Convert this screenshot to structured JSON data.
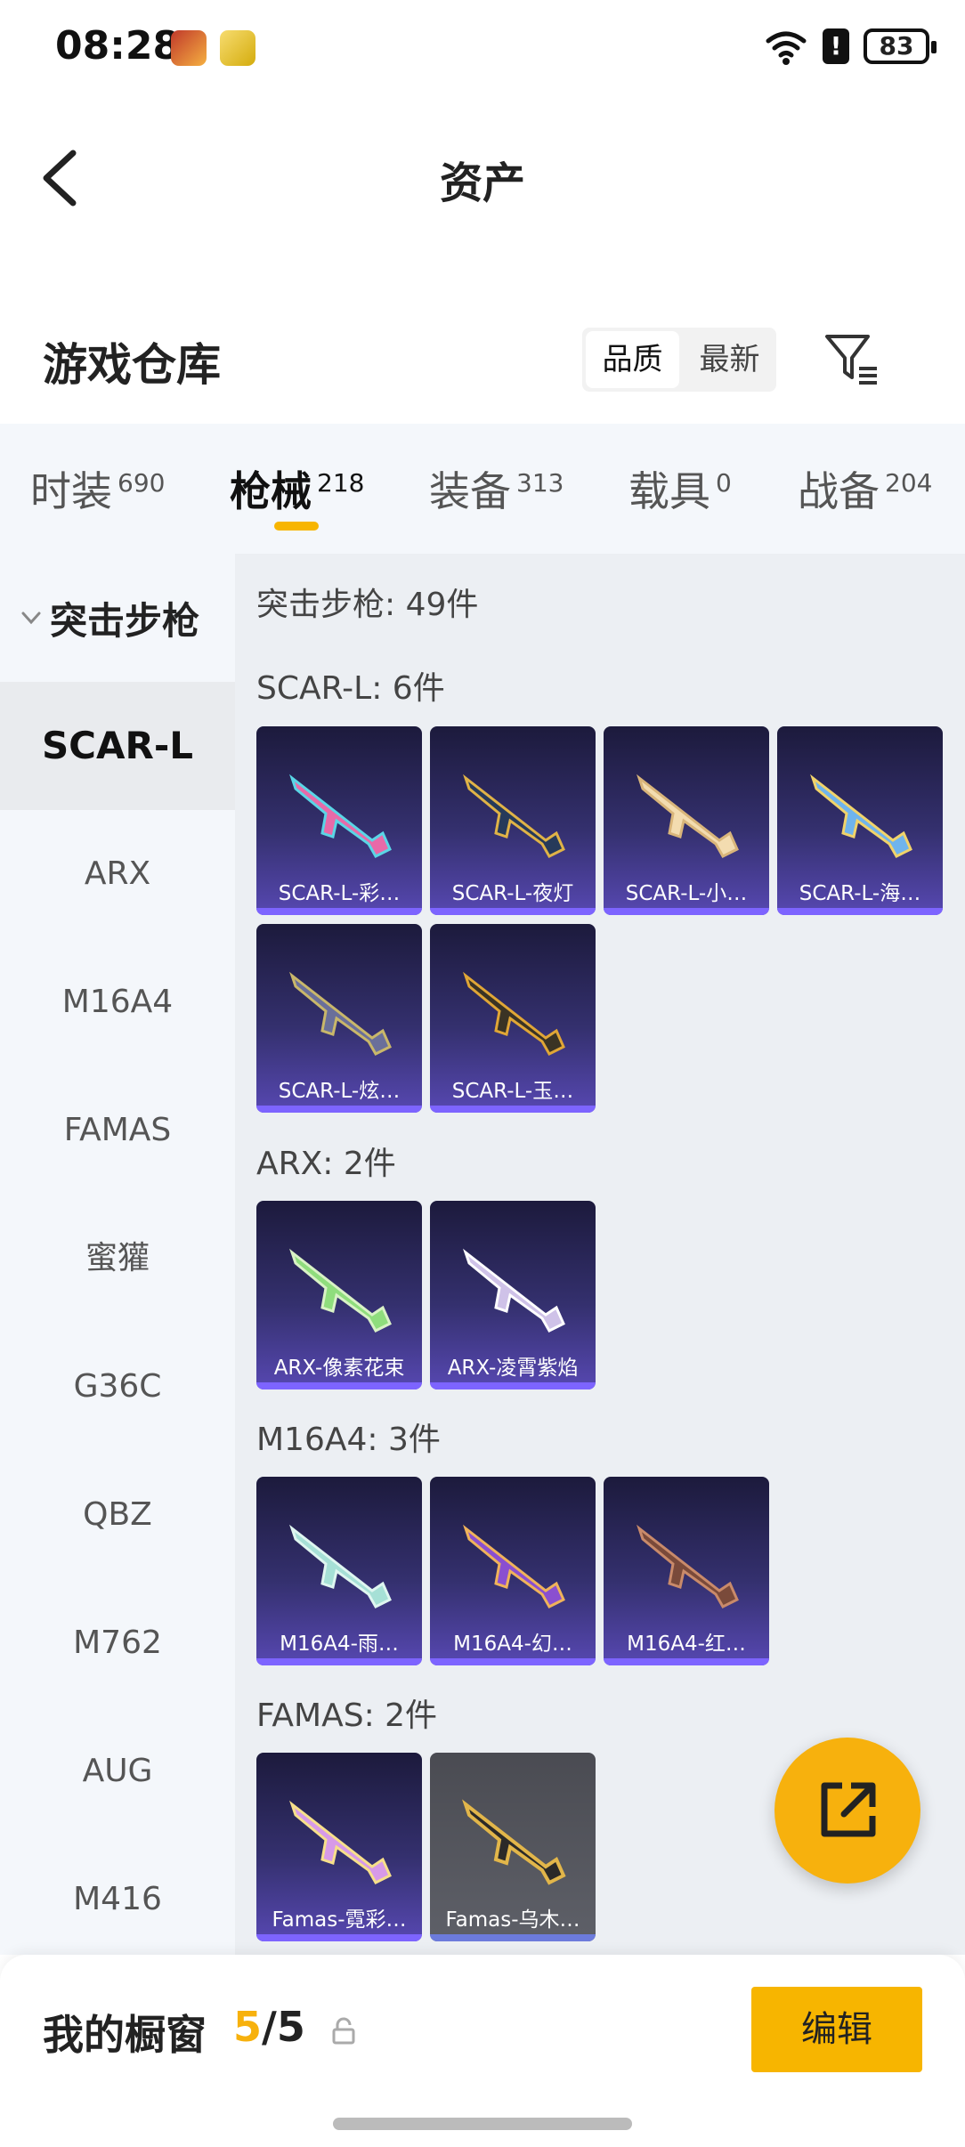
{
  "status": {
    "time": "08:28",
    "battery": "83"
  },
  "header": {
    "title": "资产",
    "back_icon": "chevron-left-icon"
  },
  "warehouse": {
    "title": "游戏仓库",
    "sort_options": [
      "品质",
      "最新"
    ],
    "active_sort": "品质",
    "filter_icon": "filter-icon"
  },
  "tabs": [
    {
      "label": "时装",
      "count": "690"
    },
    {
      "label": "枪械",
      "count": "218"
    },
    {
      "label": "装备",
      "count": "313"
    },
    {
      "label": "载具",
      "count": "0"
    },
    {
      "label": "战备",
      "count": "204"
    }
  ],
  "active_tab": "枪械",
  "sidebar": {
    "category": "突击步枪",
    "items": [
      "SCAR-L",
      "ARX",
      "M16A4",
      "FAMAS",
      "蜜獾",
      "G36C",
      "QBZ",
      "M762",
      "AUG",
      "M416"
    ],
    "active_item": "SCAR-L"
  },
  "main": {
    "category_heading": "突击步枪: 49件",
    "groups": [
      {
        "heading": "SCAR-L: 6件",
        "items": [
          {
            "label": "SCAR-L-彩…"
          },
          {
            "label": "SCAR-L-夜灯"
          },
          {
            "label": "SCAR-L-小…"
          },
          {
            "label": "SCAR-L-海…"
          },
          {
            "label": "SCAR-L-炫…"
          },
          {
            "label": "SCAR-L-玉…"
          }
        ]
      },
      {
        "heading": "ARX: 2件",
        "items": [
          {
            "label": "ARX-像素花束"
          },
          {
            "label": "ARX-凌霄紫焰"
          }
        ]
      },
      {
        "heading": "M16A4: 3件",
        "items": [
          {
            "label": "M16A4-雨…"
          },
          {
            "label": "M16A4-幻…"
          },
          {
            "label": "M16A4-红…"
          }
        ]
      },
      {
        "heading": "FAMAS: 2件",
        "items": [
          {
            "label": "Famas-霓彩…"
          },
          {
            "label": "Famas-乌木…"
          }
        ]
      }
    ]
  },
  "fab": {
    "icon": "share-external-icon"
  },
  "bottom": {
    "window_label": "我的橱窗",
    "window_current": "5",
    "window_total": "/5",
    "edit_label": "编辑"
  },
  "colors": {
    "accent": "#f7b500",
    "card_purple": "#34306e"
  }
}
